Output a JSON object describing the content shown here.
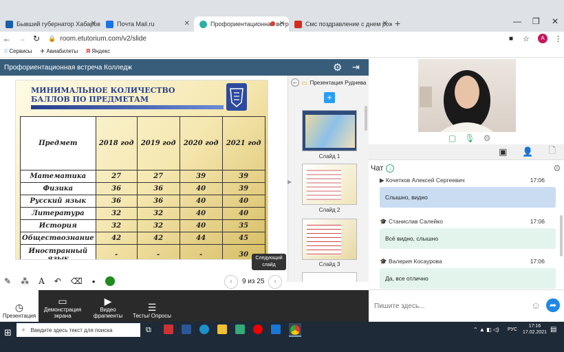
{
  "tabs": [
    {
      "title": "Бывший губернатор Хабаровск",
      "color": "#1a5ea8"
    },
    {
      "title": "Почта Mail.ru",
      "color": "#1a73e8"
    },
    {
      "title": "Профориентационная встре",
      "color": "#2bb0a2"
    },
    {
      "title": "Смс поздравление с днем рожд",
      "color": "#d52b1e"
    }
  ],
  "address": "room.etutorium.com/v2/slide",
  "bookmarks": [
    "Сервисы",
    "Авиабилеты",
    "Яндекс"
  ],
  "profile_initial": "A",
  "header_title": "Профориентационная встреча Колледж",
  "slide": {
    "title": "МИНИМАЛЬНОЕ КОЛИЧЕСТВО БАЛЛОВ ПО ПРЕДМЕТАМ",
    "headers": [
      "Предмет",
      "2018 год",
      "2019 год",
      "2020 год",
      "2021 год"
    ],
    "rows": [
      [
        "Математика",
        "27",
        "27",
        "39",
        "39"
      ],
      [
        "Физика",
        "36",
        "36",
        "40",
        "39"
      ],
      [
        "Русский язык",
        "36",
        "36",
        "40",
        "40"
      ],
      [
        "Литература",
        "32",
        "32",
        "40",
        "40"
      ],
      [
        "История",
        "32",
        "32",
        "40",
        "35"
      ],
      [
        "Обществознание",
        "42",
        "42",
        "44",
        "45"
      ],
      [
        "Иностранный язык",
        "-",
        "-",
        "-",
        "30"
      ]
    ]
  },
  "presentation_name": "Презентация Руднева",
  "thumbs": [
    "Слайд 1",
    "Слайд 2",
    "Слайд 3"
  ],
  "page_counter": "9 из 25",
  "tooltip": "Следующий слайд",
  "bottom_buttons": [
    "Презентация",
    "Демонстрация экрана",
    "Видео фрагменты",
    "Тесты/ Опросы"
  ],
  "chat_title": "Чат",
  "messages": [
    {
      "author": "Кочетков Алексей Сергеевич",
      "time": "17:06",
      "text": "Слышно, видно",
      "bg": "#c9dcf2"
    },
    {
      "author": "Станислав Салейко",
      "time": "17:06",
      "text": "Всё видно, слышно",
      "bg": "#e3f4ec"
    },
    {
      "author": "Валерия Косаурова",
      "time": "17:06",
      "text": "Да, все отлично",
      "bg": "#e3f4ec"
    }
  ],
  "chat_placeholder": "Пишите здесь...",
  "search_text": "Введите здесь текст для поиска",
  "lang": "РУС",
  "clock_time": "17:16",
  "clock_date": "17.02.2021"
}
